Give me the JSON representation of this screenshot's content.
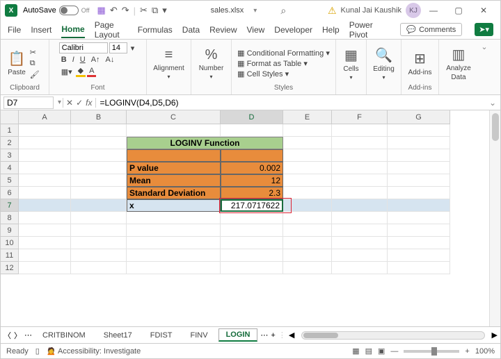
{
  "titlebar": {
    "autosave": "AutoSave",
    "autosave_state": "Off",
    "filename": "sales.xlsx",
    "search_icon": "⌕",
    "user_name": "Kunal Jai Kaushik",
    "user_initials": "KJ"
  },
  "menu": {
    "file": "File",
    "insert": "Insert",
    "home": "Home",
    "page_layout": "Page Layout",
    "formulas": "Formulas",
    "data": "Data",
    "review": "Review",
    "view": "View",
    "developer": "Developer",
    "help": "Help",
    "power_pivot": "Power Pivot",
    "comments": "Comments"
  },
  "ribbon": {
    "paste": "Paste",
    "clipboard": "Clipboard",
    "font_name": "Calibri",
    "font_size": "14",
    "font": "Font",
    "alignment": "Alignment",
    "number": "Number",
    "cond_fmt": "Conditional Formatting",
    "as_table": "Format as Table",
    "cell_styles": "Cell Styles",
    "styles": "Styles",
    "cells": "Cells",
    "editing": "Editing",
    "addins": "Add-ins",
    "analyze": "Analyze",
    "data": "Data",
    "addins_label": "Add-ins"
  },
  "formula_bar": {
    "cell_ref": "D7",
    "formula": "=LOGINV(D4,D5,D6)"
  },
  "columns": [
    "A",
    "B",
    "C",
    "D",
    "E",
    "F",
    "G"
  ],
  "rows": [
    "1",
    "2",
    "3",
    "4",
    "5",
    "6",
    "7",
    "8",
    "9",
    "10",
    "11",
    "12"
  ],
  "sheet": {
    "title": "LOGINV Function",
    "r4_label": "P value",
    "r4_val": "0.002",
    "r5_label": "Mean",
    "r5_val": "12",
    "r6_label": "Standard Deviation",
    "r6_val": "2.3",
    "r7_label": "x",
    "r7_val": "217.0717622"
  },
  "chart_data": {
    "type": "table",
    "title": "LOGINV Function",
    "rows": [
      {
        "label": "P value",
        "value": 0.002
      },
      {
        "label": "Mean",
        "value": 12
      },
      {
        "label": "Standard Deviation",
        "value": 2.3
      },
      {
        "label": "x",
        "value": 217.0717622
      }
    ]
  },
  "sheet_tabs": {
    "t1": "CRITBINOM",
    "t2": "Sheet17",
    "t3": "FDIST",
    "t4": "FINV",
    "t5": "LOGIN"
  },
  "status": {
    "ready": "Ready",
    "accessibility": "Accessibility: Investigate",
    "zoom": "100%"
  }
}
